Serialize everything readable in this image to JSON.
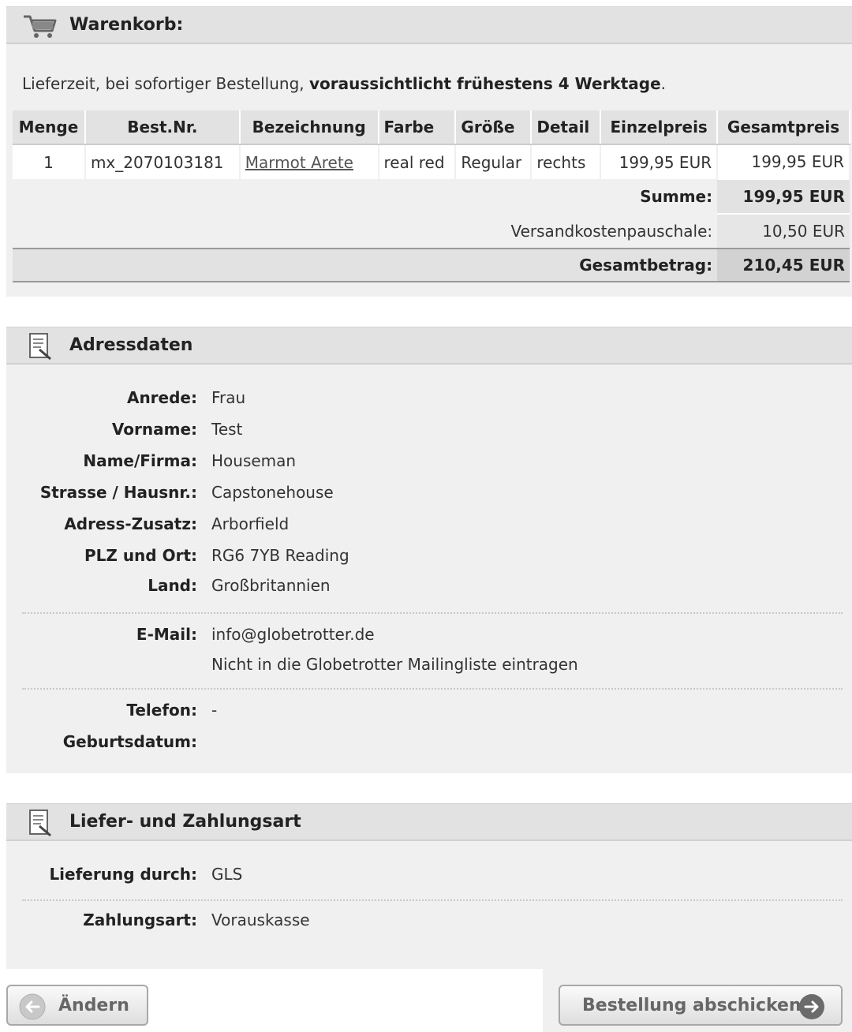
{
  "cart": {
    "title": "Warenkorb:",
    "delivery_prefix": "Lieferzeit, bei sofortiger Bestellung, ",
    "delivery_bold": "voraussichtlicht frühestens 4 Werktage",
    "delivery_suffix": ".",
    "headers": [
      "Menge",
      "Best.Nr.",
      "Bezeichnung",
      "Farbe",
      "Größe",
      "Detail",
      "Einzelpreis",
      "Gesamtpreis"
    ],
    "items": [
      {
        "qty": "1",
        "number": "mx_2070103181",
        "name": "Marmot Arete",
        "color": "real red",
        "size": "Regular",
        "detail": "rechts",
        "unit_price": "199,95 EUR",
        "total_price": "199,95 EUR"
      }
    ],
    "sum_label": "Summe:",
    "sum_value": "199,95 EUR",
    "shipping_label": "Versandkostenpauschale:",
    "shipping_value": "10,50 EUR",
    "total_label": "Gesamtbetrag:",
    "total_value": "210,45 EUR"
  },
  "address": {
    "title": "Adressdaten",
    "salutation_label": "Anrede:",
    "salutation": "Frau",
    "firstname_label": "Vorname:",
    "firstname": "Test",
    "name_label": "Name/Firma:",
    "name": "Houseman",
    "street_label": "Strasse / Hausnr.:",
    "street": "Capstonehouse",
    "extra_label": "Adress-Zusatz:",
    "extra": "Arborfield",
    "city_label": "PLZ und Ort:",
    "city": "RG6 7YB Reading",
    "country_label": "Land:",
    "country": "Großbritannien",
    "email_label": "E-Mail:",
    "email": "info@globetrotter.de",
    "newsletter": "Nicht in die Globetrotter Mailingliste eintragen",
    "phone_label": "Telefon:",
    "phone": "-",
    "birthday_label": "Geburtsdatum:",
    "birthday": ""
  },
  "shipping_payment": {
    "title": "Liefer- und Zahlungsart",
    "delivery_label": "Lieferung durch:",
    "delivery": "GLS",
    "payment_label": "Zahlungsart:",
    "payment": "Vorauskasse"
  },
  "buttons": {
    "back": "Ändern",
    "submit": "Bestellung abschicken"
  },
  "icons": {
    "cart": "cart-icon",
    "address": "document-edit-icon",
    "shipping": "document-edit-icon",
    "back": "arrow-left-circle-icon",
    "submit": "arrow-right-circle-icon"
  }
}
